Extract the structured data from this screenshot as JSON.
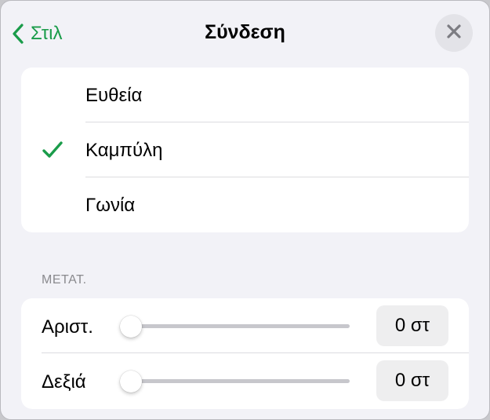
{
  "header": {
    "back_label": "Στιλ",
    "title": "Σύνδεση"
  },
  "options": [
    {
      "label": "Ευθεία",
      "selected": false
    },
    {
      "label": "Καμπύλη",
      "selected": true
    },
    {
      "label": "Γωνία",
      "selected": false
    }
  ],
  "offset_section": {
    "title": "ΜΕΤΑΤ.",
    "rows": [
      {
        "label": "Αριστ.",
        "value": "0 στ",
        "level": 0
      },
      {
        "label": "Δεξιά",
        "value": "0 στ",
        "level": 0
      }
    ]
  },
  "colors": {
    "accent": "#1a9c4a",
    "background": "#f2f2f7",
    "card": "#ffffff"
  },
  "icons": {
    "back": "chevron-left-icon",
    "close": "close-icon",
    "check": "checkmark-icon"
  }
}
